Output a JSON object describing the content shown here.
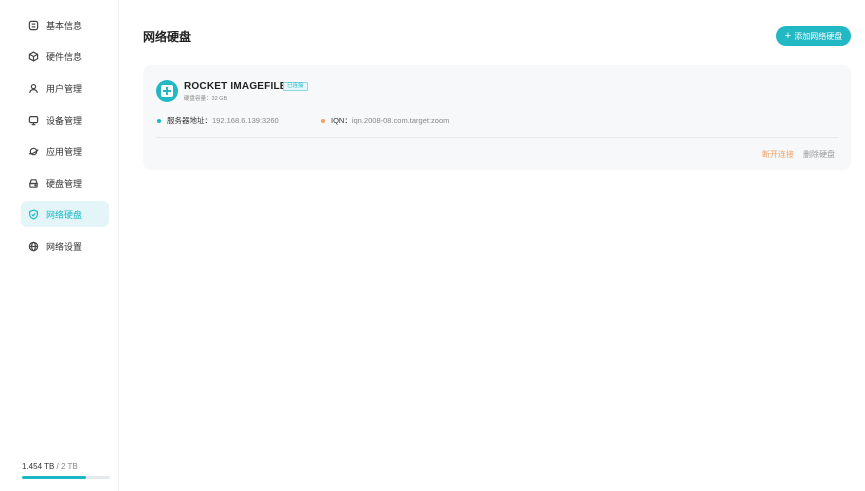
{
  "sidebar": {
    "items": [
      {
        "label": "基本信息",
        "icon": "info-card-icon"
      },
      {
        "label": "硬件信息",
        "icon": "cube-icon"
      },
      {
        "label": "用户管理",
        "icon": "user-icon"
      },
      {
        "label": "设备管理",
        "icon": "monitor-icon"
      },
      {
        "label": "应用管理",
        "icon": "planet-icon"
      },
      {
        "label": "硬盘管理",
        "icon": "hard-drive-icon"
      },
      {
        "label": "网络硬盘",
        "icon": "shield-check-icon"
      },
      {
        "label": "网络设置",
        "icon": "globe-icon"
      }
    ],
    "active_item": "网络硬盘",
    "storage": {
      "used": "1.454 TB",
      "separator": " / ",
      "total": "2 TB",
      "used_fraction": 0.727
    }
  },
  "main": {
    "title": "网络硬盘",
    "add_button": {
      "plus": "+",
      "label": "添加网络硬盘"
    }
  },
  "disks": [
    {
      "name": "ROCKET IMAGEFILE",
      "status": "已连接",
      "capacity_label": "硬盘容量：",
      "capacity_value": "32 GB",
      "server_label": "服务器地址：",
      "server_value": "192.168.6.139:3260",
      "iqn_label": "IQN：",
      "iqn_value": "iqn.2008-08.com.target:zoom",
      "disconnect_label": "断开连接",
      "delete_label": "删除硬盘"
    }
  ],
  "colors": {
    "accent": "#1bb7c4",
    "warning": "#f0a064",
    "server_dot": "#1bb7c4",
    "iqn_dot": "#f0a064"
  }
}
